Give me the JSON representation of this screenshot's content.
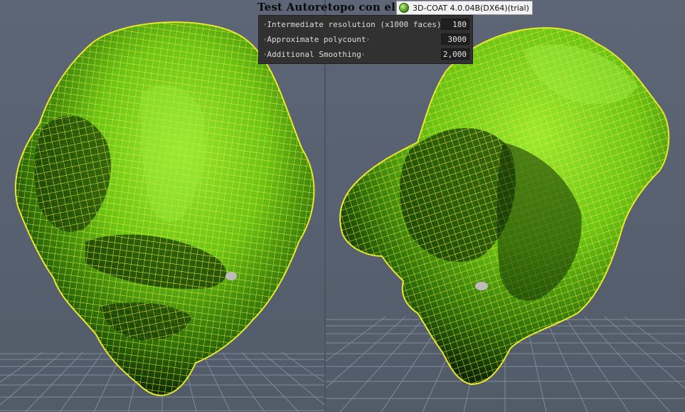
{
  "title": "Test Autoretopo con el",
  "app_badge": {
    "icon": "3dcoat-app-icon",
    "label": "3D-COAT 4.0.04B(DX64)(trial)"
  },
  "panel": {
    "params": [
      {
        "label": "Intermediate resolution (x1000 faces)",
        "value": "180"
      },
      {
        "label": "Approximate polycount",
        "value": "3000"
      },
      {
        "label": "Additional Smoothing",
        "value": "2,000"
      }
    ],
    "arrow_left": "‹",
    "arrow_right": "›"
  },
  "colors": {
    "viewport_bg": "#5a6473",
    "grid_line": "#8d96a3",
    "mesh_fill": "#7fd81e",
    "mesh_shadow": "#123806",
    "wireframe": "#f3f338",
    "panel_bg": "#313131"
  }
}
